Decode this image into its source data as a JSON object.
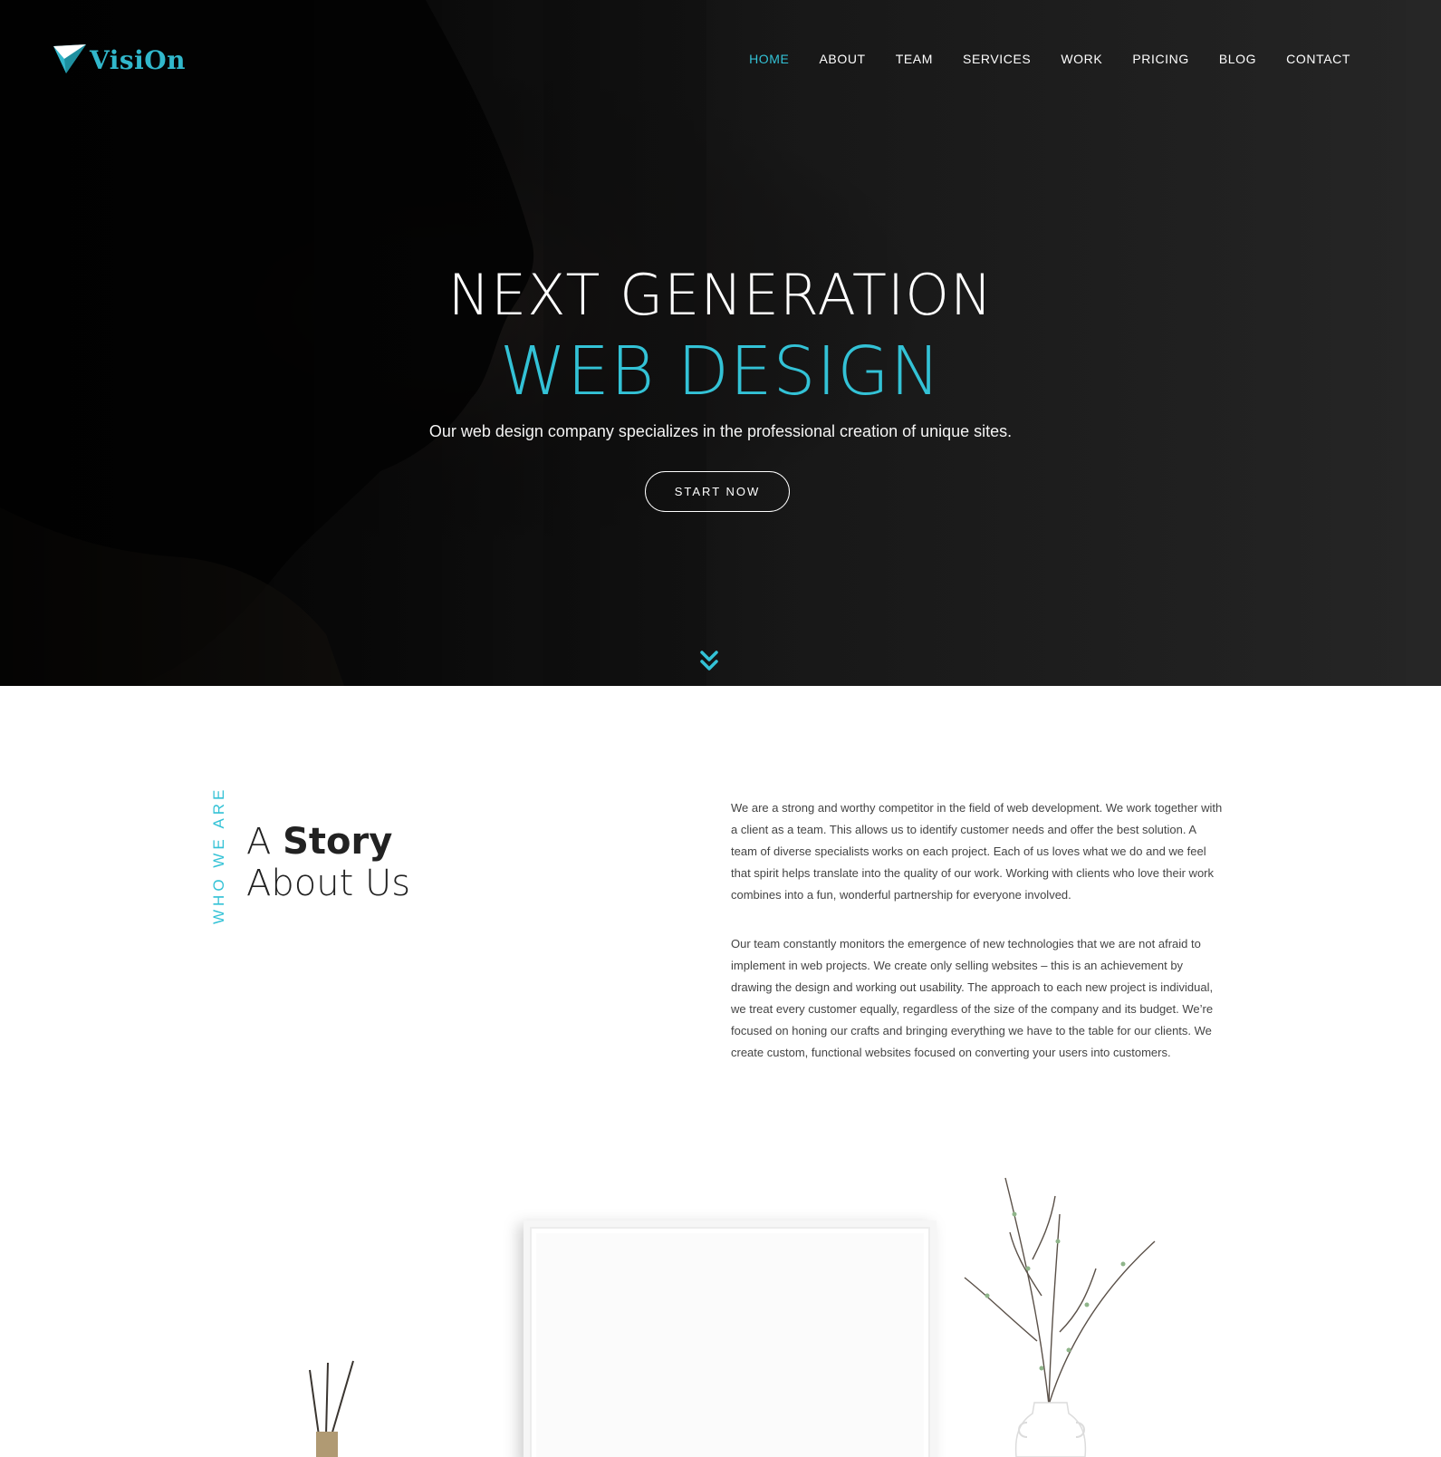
{
  "brand": {
    "logo_text": "VisiOn",
    "accent_color": "#33c2d6"
  },
  "nav": {
    "items": [
      "HOME",
      "ABOUT",
      "TEAM",
      "SERVICES",
      "WORK",
      "PRICING",
      "BLOG",
      "CONTACT"
    ],
    "active": "HOME"
  },
  "hero": {
    "title_line1": "NEXT GENERATION",
    "title_line2": "WEB DESIGN",
    "subtitle": "Our web design company specializes in the professional creation of unique sites.",
    "cta_label": "START NOW",
    "scroll_icon": "double-chevron-down-icon"
  },
  "about": {
    "side_label": "WHO WE ARE",
    "heading_prefix": "A ",
    "heading_bold": "Story",
    "heading_line2": "About Us",
    "paragraph1": "We are a strong and worthy competitor in the field of web development. We work together with a client as a team. This allows us to identify customer needs and offer the best solution. A team of diverse specialists works on each project. Each of us loves what we do and we feel that spirit helps translate into the quality of our work. Working with clients who love their work combines into a fun, wonderful partnership for everyone involved.",
    "paragraph2": "Our team constantly monitors the emergence of new technologies that we are not afraid to implement in web projects. We create only selling websites – this is an achievement by drawing the design and working out usability. The approach to each new project is individual, we treat every customer equally, regardless of the size of the company and its budget. We’re focused on honing our crafts and bringing everything we have to the table for our clients. We create custom, functional websites focused on converting your users into customers."
  }
}
